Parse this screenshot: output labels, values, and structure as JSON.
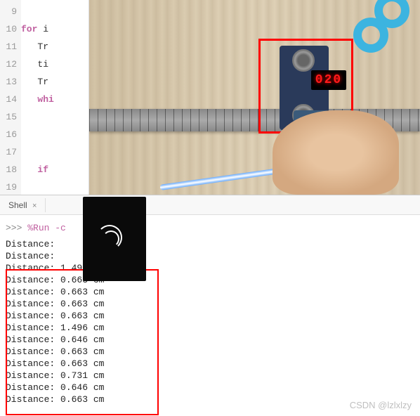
{
  "code": {
    "line_numbers": [
      "9",
      "10",
      "11",
      "12",
      "13",
      "14",
      "15",
      "16",
      "17",
      "18",
      "19"
    ],
    "lines": [
      {
        "type": "kw",
        "kw": "for",
        "rest": " i "
      },
      {
        "type": "text",
        "rest": "   Tr"
      },
      {
        "type": "text",
        "rest": "   ti"
      },
      {
        "type": "text",
        "rest": "   Tr"
      },
      {
        "type": "kw",
        "kw": "whi",
        "rest": "",
        "indent": "   "
      },
      {
        "type": "blank"
      },
      {
        "type": "blank"
      },
      {
        "type": "blank"
      },
      {
        "type": "kw",
        "kw": "if",
        "rest": "",
        "indent": "   "
      },
      {
        "type": "blank"
      },
      {
        "type": "blank"
      }
    ]
  },
  "led_display": "020",
  "shell": {
    "tab_label": "Shell",
    "tab_close": "×",
    "prompt": ">>>",
    "command": "%Run  -c",
    "initial_output": [
      "Distance:",
      "Distance:"
    ],
    "boxed_output": [
      "Distance: 1.496 cm",
      "Distance: 0.663 cm",
      "Distance: 0.663 cm",
      "Distance: 0.663 cm",
      "Distance: 0.663 cm",
      "Distance: 1.496 cm",
      "Distance: 0.646 cm",
      "Distance: 0.663 cm",
      "Distance: 0.663 cm",
      "Distance: 0.731 cm",
      "Distance: 0.646 cm",
      "Distance: 0.663 cm"
    ]
  },
  "watermark": "CSDN @lzlxlzy"
}
